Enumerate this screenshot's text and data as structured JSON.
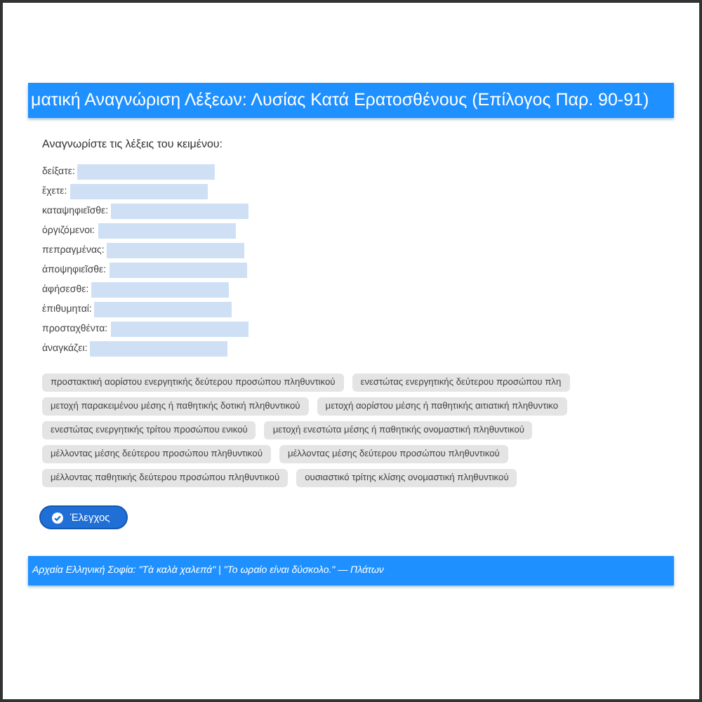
{
  "title": "ματική Αναγνώριση Λέξεων: Λυσίας Κατά Ερατοσθένους (Επίλογος Παρ. 90-91)",
  "instruction": "Αναγνωρίστε τις λέξεις του κειμένου:",
  "fields": [
    {
      "label": "δείξατε:"
    },
    {
      "label": "ἔχετε:"
    },
    {
      "label": "καταψηφιεῖσθε:"
    },
    {
      "label": "ὀργιζόμενοι:"
    },
    {
      "label": "πεπραγμένας:"
    },
    {
      "label": "ἀποψηφιεῖσθε:"
    },
    {
      "label": "ἀφήσεσθε:"
    },
    {
      "label": "ἐπιθυμηταί:"
    },
    {
      "label": "προσταχθέντα:"
    },
    {
      "label": "ἀναγκάζει:"
    }
  ],
  "choice_rows": [
    [
      "προστακτική αορίστου ενεργητικής δεύτερου προσώπου πληθυντικού",
      "ενεστώτας ενεργητικής δεύτερου προσώπου πλη"
    ],
    [
      "μετοχή παρακειμένου μέσης ή παθητικής δοτική πληθυντικού",
      "μετοχή αορίστου μέσης ή παθητικής αιτιατική πληθυντικο"
    ],
    [
      "ενεστώτας ενεργητικής τρίτου προσώπου ενικού",
      "μετοχή ενεστώτα μέσης ή παθητικής ονομαστική πληθυντικού"
    ],
    [
      "μέλλοντας μέσης δεύτερου προσώπου πληθυντικού",
      "μέλλοντας μέσης δεύτερου προσώπου πληθυντικού"
    ],
    [
      "μέλλοντας παθητικής δεύτερου προσώπου πληθυντικού",
      "ουσιαστικό τρίτης κλίσης ονομαστική πληθυντικού"
    ]
  ],
  "check_button": "Έλεγχος",
  "footer": "Αρχαία Ελληνική Σοφία: \"Τὰ καλὰ χαλεπά\" | \"Το ωραίο είναι δύσκολο.\" — Πλάτων"
}
